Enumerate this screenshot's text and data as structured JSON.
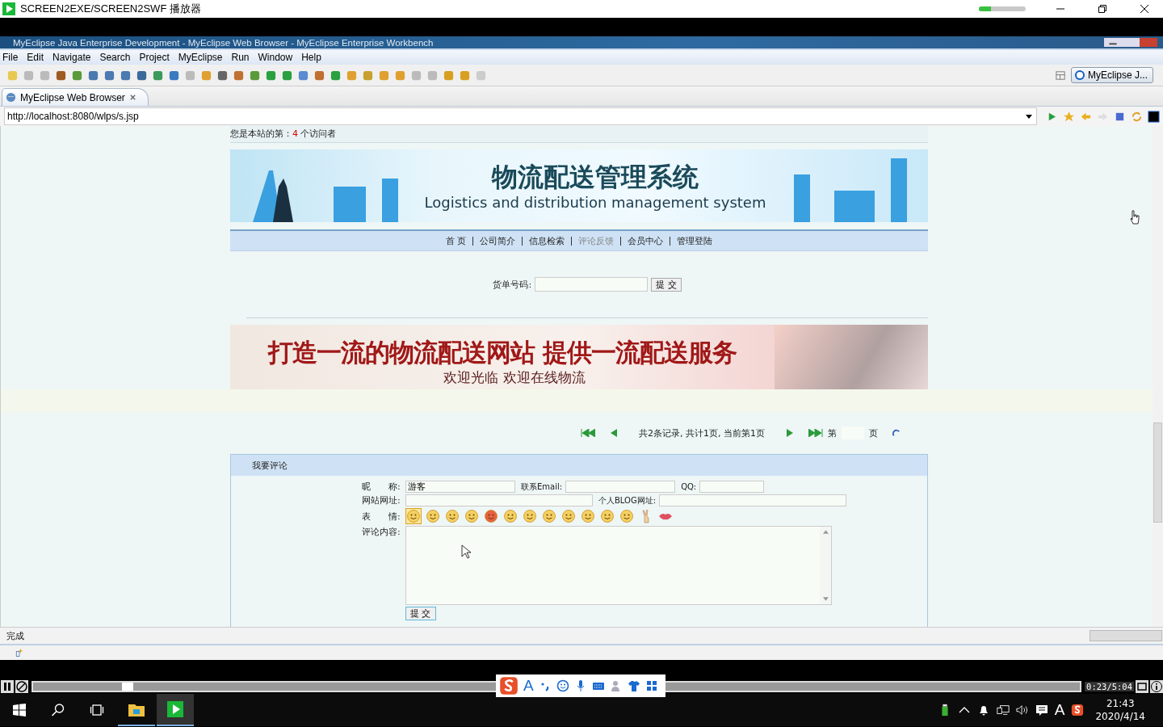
{
  "player_window": {
    "title": "SCREEN2EXE/SCREEN2SWF 播放器",
    "loading_bar": {
      "level": 0.25
    }
  },
  "ide": {
    "title": "MyEclipse Java Enterprise Development - MyEclipse Web Browser - MyEclipse Enterprise Workbench",
    "menu": [
      "File",
      "Edit",
      "Navigate",
      "Search",
      "Project",
      "MyEclipse",
      "Run",
      "Window",
      "Help"
    ],
    "perspective_button": "MyEclipse J...",
    "tab": {
      "label": "MyEclipse Web Browser",
      "selected": true
    },
    "address": "http://localhost:8080/wlps/s.jsp",
    "status": "完成"
  },
  "page": {
    "visitor": {
      "prefix": "您是本站的第：",
      "count": "4",
      "suffix": "个访问者"
    },
    "banner": {
      "title": "物流配送管理系统",
      "subtitle": "Logistics and distribution management system"
    },
    "nav": [
      {
        "label": "首 页",
        "selected": false
      },
      {
        "label": "公司简介",
        "selected": false
      },
      {
        "label": "信息检索",
        "selected": false
      },
      {
        "label": "评论反馈",
        "selected": true
      },
      {
        "label": "会员中心",
        "selected": false
      },
      {
        "label": "管理登陆",
        "selected": false
      }
    ],
    "tracking": {
      "label": "货单号码:",
      "button": "提 交"
    },
    "ad_banner": {
      "headline": "打造一流的物流配送网站 提供一流配送服务",
      "subline": "欢迎光临 欢迎在线物流"
    },
    "pager": {
      "summary": "共2条记录, 共计1页, 当前第1页",
      "page_prefix": "第",
      "page_suffix": "页"
    },
    "comment_form": {
      "title": "我要评论",
      "nickname": {
        "label": "昵　　称:",
        "value": "游客"
      },
      "email": {
        "label": "联系Email:"
      },
      "qq": {
        "label": "QQ:"
      },
      "website": {
        "label": "网站网址:"
      },
      "blog": {
        "label": "个人BLOG网址:"
      },
      "emotion_label": "表　　情:",
      "emoticons": [
        {
          "kind": "face",
          "selected": true
        },
        {
          "kind": "face",
          "selected": false
        },
        {
          "kind": "face",
          "selected": false
        },
        {
          "kind": "face",
          "selected": false
        },
        {
          "kind": "angry",
          "selected": false
        },
        {
          "kind": "face",
          "selected": false
        },
        {
          "kind": "face",
          "selected": false
        },
        {
          "kind": "face",
          "selected": false
        },
        {
          "kind": "face",
          "selected": false
        },
        {
          "kind": "face",
          "selected": false
        },
        {
          "kind": "face",
          "selected": false
        },
        {
          "kind": "face",
          "selected": false
        },
        {
          "kind": "hand",
          "selected": false
        },
        {
          "kind": "lips",
          "selected": false
        }
      ],
      "content_label": "评论内容:",
      "submit": "提 交"
    }
  },
  "player": {
    "level": 0.085,
    "time": "0:23/5:04"
  },
  "ime_toolbar": {
    "mode": "A"
  },
  "taskbar": {
    "ime": "A",
    "time": "21:43",
    "date": "2020/4/14"
  }
}
